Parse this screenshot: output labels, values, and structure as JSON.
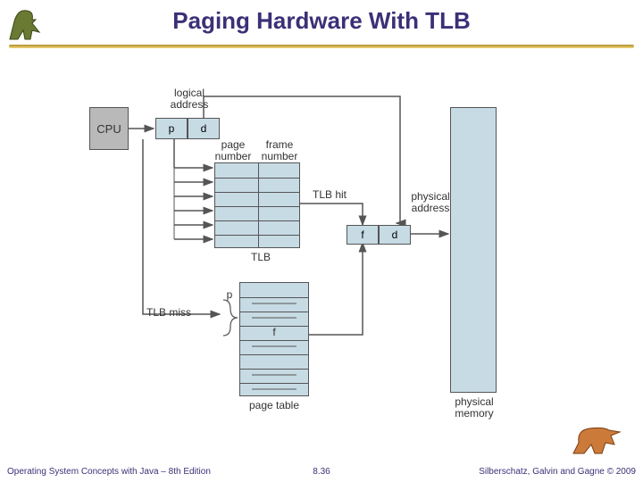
{
  "slide": {
    "title": "Paging Hardware With TLB",
    "page_number": "8.36"
  },
  "footer": {
    "left": "Operating System Concepts with Java – 8th Edition",
    "right": "Silberschatz, Galvin and Gagne © 2009"
  },
  "diagram": {
    "cpu": "CPU",
    "logical_address": "logical\naddress",
    "p": "p",
    "d": "d",
    "page_number": "page\nnumber",
    "frame_number": "frame\nnumber",
    "tlb": "TLB",
    "tlb_hit": "TLB hit",
    "tlb_miss": "TLB miss",
    "f": "f",
    "page_table": "page table",
    "physical_address": "physical\naddress",
    "physical_memory": "physical\nmemory"
  }
}
